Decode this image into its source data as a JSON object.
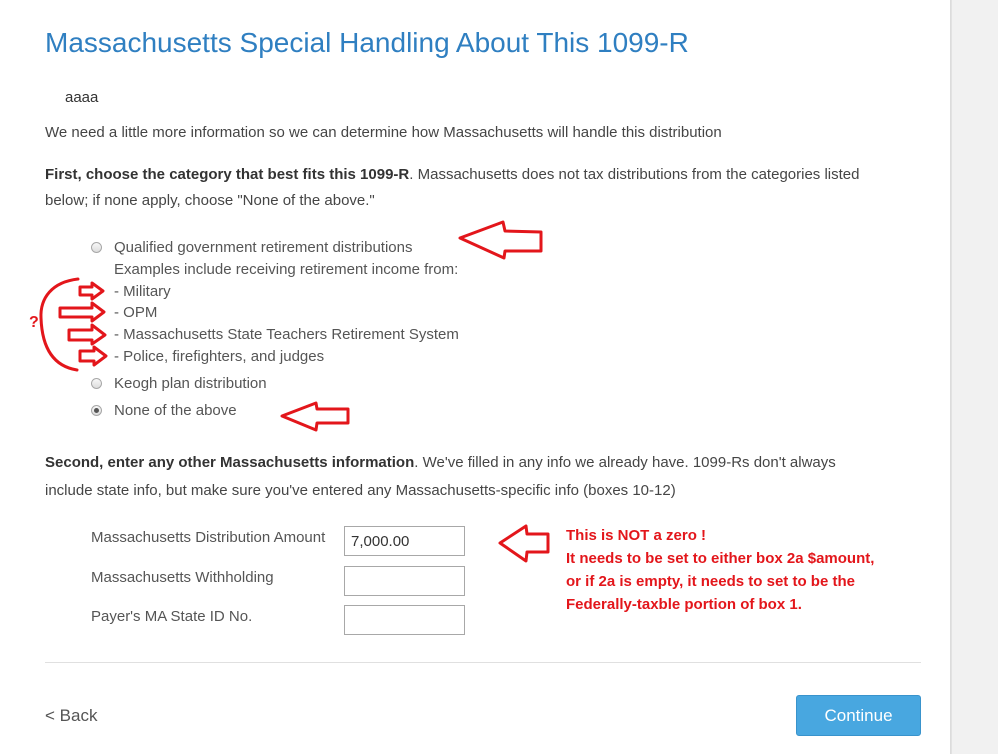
{
  "page": {
    "title": "Massachusetts Special Handling About This 1099-R",
    "payer_name": "aaaa",
    "intro": "We need a little more information so we can determine how Massachusetts will handle this distribution",
    "first_bold": "First, choose the category that best fits this 1099-R",
    "first_rest": ". Massachusetts does not tax distributions from the categories listed",
    "first_line2": "below; if none apply, choose \"None of the above.\"",
    "second_bold": "Second, enter any other Massachusetts information",
    "second_rest": ". We've filled in any info we already have. 1099-Rs don't always",
    "second_line2": "include state info, but make sure you've entered any Massachusetts-specific info (boxes 10-12)"
  },
  "options": {
    "qualified_label": "Qualified government retirement distributions",
    "examples_intro": "Examples include receiving retirement income from:",
    "examples": [
      "- Military",
      "- OPM",
      "- Massachusetts State Teachers Retirement System",
      "- Police, firefighters, and judges"
    ],
    "keogh_label": "Keogh plan distribution",
    "none_label": "None of the above",
    "selected": "None of the above"
  },
  "fields": {
    "distribution_label": "Massachusetts Distribution Amount",
    "distribution_value": "7,000.00",
    "withholding_label": "Massachusetts Withholding",
    "withholding_value": "",
    "state_id_label": "Payer's MA State ID No.",
    "state_id_value": ""
  },
  "nav": {
    "back_label": "< Back",
    "continue_label": "Continue"
  },
  "annotation": {
    "question_mark": "?",
    "note_lines": [
      "This is NOT a zero   !",
      "It needs to be set to either box 2a $amount,",
      "or if 2a is empty, it needs to set to be the",
      "Federally-taxble portion of box 1."
    ]
  },
  "colors": {
    "title": "#2f7fc1",
    "continue_button": "#48a7e0",
    "annotation_red": "#e3161b"
  }
}
